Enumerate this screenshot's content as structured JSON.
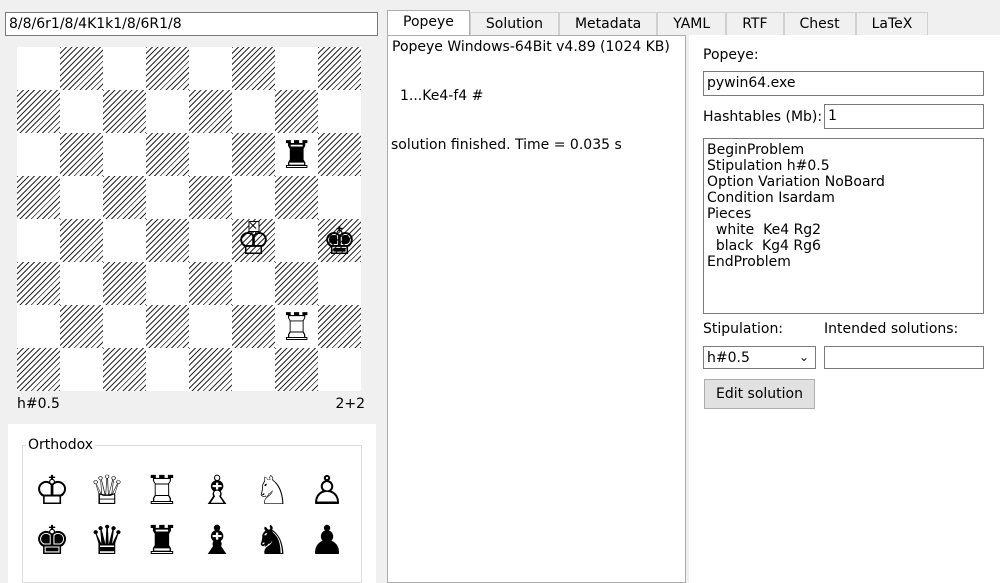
{
  "fen_input": "8/8/6r1/8/4K1k1/8/6R1/8",
  "board": {
    "stipulation": "h#0.5",
    "piece_count": "2+2",
    "rows": [
      [
        "",
        "",
        "",
        "",
        "",
        "",
        "",
        ""
      ],
      [
        "",
        "",
        "",
        "",
        "",
        "",
        "",
        ""
      ],
      [
        "",
        "",
        "",
        "",
        "",
        "",
        "♜",
        ""
      ],
      [
        "",
        "",
        "",
        "",
        "",
        "",
        "",
        ""
      ],
      [
        "",
        "",
        "",
        "",
        "",
        "♔",
        "",
        "♚"
      ],
      [
        "",
        "",
        "",
        "",
        "",
        "",
        "",
        ""
      ],
      [
        "",
        "",
        "",
        "",
        "",
        "",
        "♖",
        ""
      ],
      [
        "",
        "",
        "",
        "",
        "",
        "",
        "",
        ""
      ]
    ]
  },
  "palette": {
    "label": "Orthodox",
    "white": [
      "♔",
      "♕",
      "♖",
      "♗",
      "♘",
      "♙"
    ],
    "black": [
      "♚",
      "♛",
      "♜",
      "♝",
      "♞",
      "♟"
    ]
  },
  "tabs": [
    "Popeye",
    "Solution",
    "Metadata",
    "YAML",
    "RTF",
    "Chest",
    "LaTeX"
  ],
  "output": {
    "line1": "Popeye Windows-64Bit v4.89 (1024 KB)",
    "line2": "1...Ke4-f4 #",
    "line3": "solution finished. Time = 0.035 s"
  },
  "settings": {
    "popeye_label": "Popeye:",
    "popeye_value": "pywin64.exe",
    "hashtables_label": "Hashtables (Mb):",
    "hashtables_value": "1",
    "problem_text": [
      "BeginProblem",
      "Stipulation h#0.5",
      "Option Variation NoBoard",
      "Condition Isardam",
      "Pieces",
      "  white  Ke4 Rg2",
      "  black  Kg4 Rg6",
      "EndProblem"
    ],
    "stipulation_label": "Stipulation:",
    "stipulation_value": "h#0.5",
    "intended_label": "Intended solutions:",
    "intended_value": "",
    "edit_button": "Edit solution"
  }
}
